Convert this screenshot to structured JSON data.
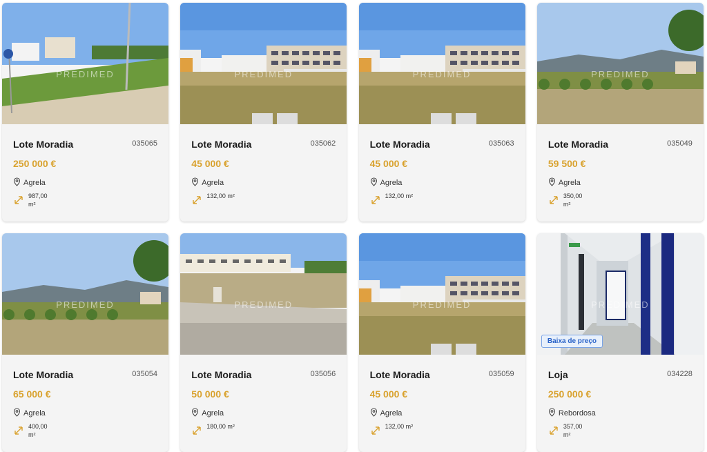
{
  "watermark": "PREDIMED",
  "cards": [
    {
      "title": "Lote Moradia",
      "ref": "035065",
      "price": "250 000 €",
      "location": "Agrela",
      "area": "987,00 m²",
      "area_wrap": true,
      "scene": "street"
    },
    {
      "title": "Lote Moradia",
      "ref": "035062",
      "price": "45 000 €",
      "location": "Agrela",
      "area": "132,00 m²",
      "area_wrap": false,
      "scene": "buildings"
    },
    {
      "title": "Lote Moradia",
      "ref": "035063",
      "price": "45 000 €",
      "location": "Agrela",
      "area": "132,00 m²",
      "area_wrap": false,
      "scene": "buildings"
    },
    {
      "title": "Lote Moradia",
      "ref": "035049",
      "price": "59 500 €",
      "location": "Agrela",
      "area": "350,00 m²",
      "area_wrap": true,
      "scene": "valley"
    },
    {
      "title": "Lote Moradia",
      "ref": "035054",
      "price": "65 000 €",
      "location": "Agrela",
      "area": "400,00 m²",
      "area_wrap": true,
      "scene": "valley"
    },
    {
      "title": "Lote Moradia",
      "ref": "035056",
      "price": "50 000 €",
      "location": "Agrela",
      "area": "180,00 m²",
      "area_wrap": false,
      "scene": "road"
    },
    {
      "title": "Lote Moradia",
      "ref": "035059",
      "price": "45 000 €",
      "location": "Agrela",
      "area": "132,00 m²",
      "area_wrap": false,
      "scene": "buildings"
    },
    {
      "title": "Loja",
      "ref": "034228",
      "price": "250 000 €",
      "location": "Rebordosa",
      "area": "357,00 m²",
      "area_wrap": true,
      "scene": "corridor",
      "badge": "Baixa de preço"
    }
  ],
  "colors": {
    "price": "#d9a22e",
    "badge": "#2a63c8"
  }
}
